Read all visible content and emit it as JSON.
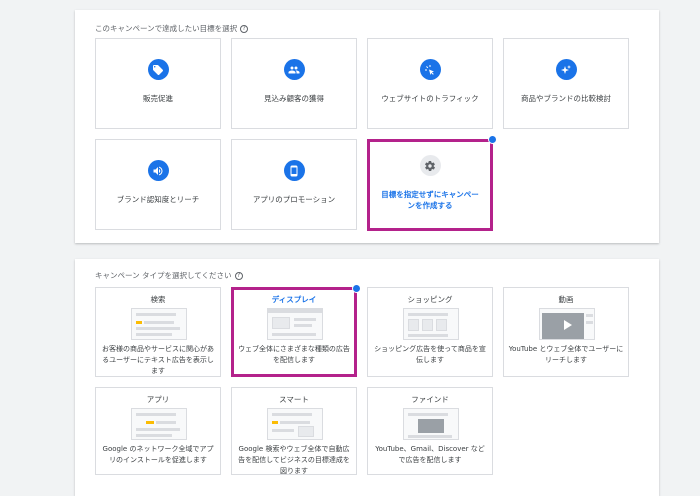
{
  "goal_section": {
    "title": "このキャンペーンで達成したい目標を選択",
    "help_icon": "?",
    "cards": [
      {
        "label": "販売促進",
        "icon": "tag-icon"
      },
      {
        "label": "見込み顧客の獲得",
        "icon": "people-icon"
      },
      {
        "label": "ウェブサイトのトラフィック",
        "icon": "cursor-click-icon"
      },
      {
        "label": "商品やブランドの比較検討",
        "icon": "sparkle-icon"
      },
      {
        "label": "ブランド認知度とリーチ",
        "icon": "speaker-icon"
      },
      {
        "label": "アプリのプロモーション",
        "icon": "phone-icon"
      },
      {
        "label": "目標を指定せずにキャンペーンを作成する",
        "icon": "gear-icon",
        "selected": true
      }
    ]
  },
  "type_section": {
    "title": "キャンペーン タイプを選択してください",
    "help_icon": "?",
    "cards": [
      {
        "title": "検索",
        "desc": "お客様の商品やサービスに関心があるユーザーにテキスト広告を表示します"
      },
      {
        "title": "ディスプレイ",
        "desc": "ウェブ全体にさまざまな種類の広告を配信します",
        "selected": true
      },
      {
        "title": "ショッピング",
        "desc": "ショッピング広告を使って商品を宣伝します"
      },
      {
        "title": "動画",
        "desc": "YouTube とウェブ全体でユーザーにリーチします"
      },
      {
        "title": "アプリ",
        "desc": "Google のネットワーク全域でアプリのインストールを促進します"
      },
      {
        "title": "スマート",
        "desc": "Google 検索やウェブ全体で自動広告を配信してビジネスの目標達成を図ります"
      },
      {
        "title": "ファインド",
        "desc": "YouTube、Gmail、Discover などで広告を配信します"
      }
    ]
  },
  "colors": {
    "accent": "#1a73e8",
    "highlight": "#b4228b",
    "warning": "#fbbc04"
  }
}
